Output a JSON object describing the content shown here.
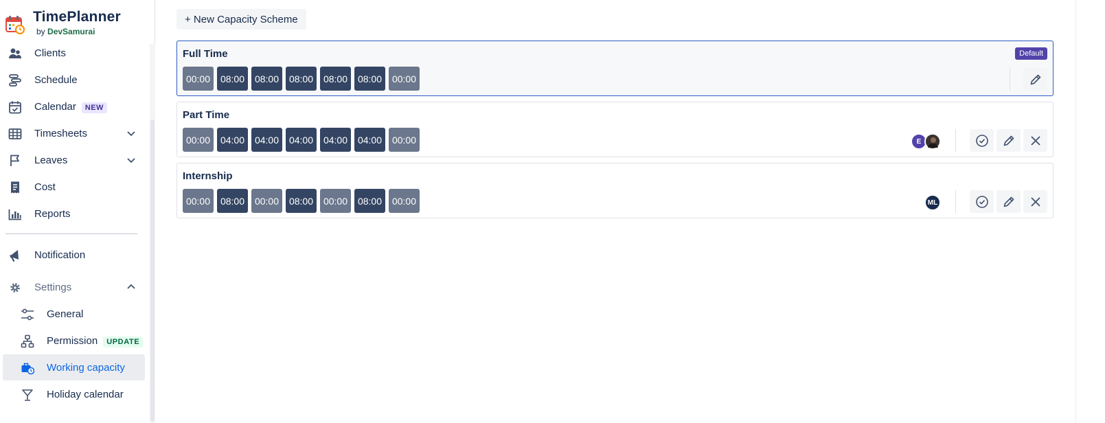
{
  "brand": {
    "name": "TimePlanner",
    "by_prefix": "by",
    "by_name": "DevSamurai"
  },
  "sidebar": {
    "items": [
      {
        "label": "Clients"
      },
      {
        "label": "Schedule"
      },
      {
        "label": "Calendar",
        "badge": "NEW"
      },
      {
        "label": "Timesheets"
      },
      {
        "label": "Leaves"
      },
      {
        "label": "Cost"
      },
      {
        "label": "Reports"
      },
      {
        "label": "Notification"
      },
      {
        "label": "Settings"
      }
    ],
    "settings_items": [
      {
        "label": "General"
      },
      {
        "label": "Permission",
        "badge": "UPDATE"
      },
      {
        "label": "Working capacity"
      },
      {
        "label": "Holiday calendar"
      }
    ]
  },
  "main": {
    "new_button": "+ New Capacity Scheme",
    "schemes": [
      {
        "name": "Full Time",
        "default_badge": "Default",
        "days": [
          "00:00",
          "08:00",
          "08:00",
          "08:00",
          "08:00",
          "08:00",
          "00:00"
        ]
      },
      {
        "name": "Part Time",
        "avatar_initial": "E",
        "days": [
          "00:00",
          "04:00",
          "04:00",
          "04:00",
          "04:00",
          "04:00",
          "00:00"
        ]
      },
      {
        "name": "Internship",
        "avatar_initial": "ML",
        "days": [
          "00:00",
          "08:00",
          "00:00",
          "08:00",
          "00:00",
          "08:00",
          "00:00"
        ]
      }
    ]
  },
  "colors": {
    "day_on": "#344563",
    "day_off": "#6b778c",
    "default_badge": "#5243aa",
    "active_link": "#0c66e4"
  }
}
